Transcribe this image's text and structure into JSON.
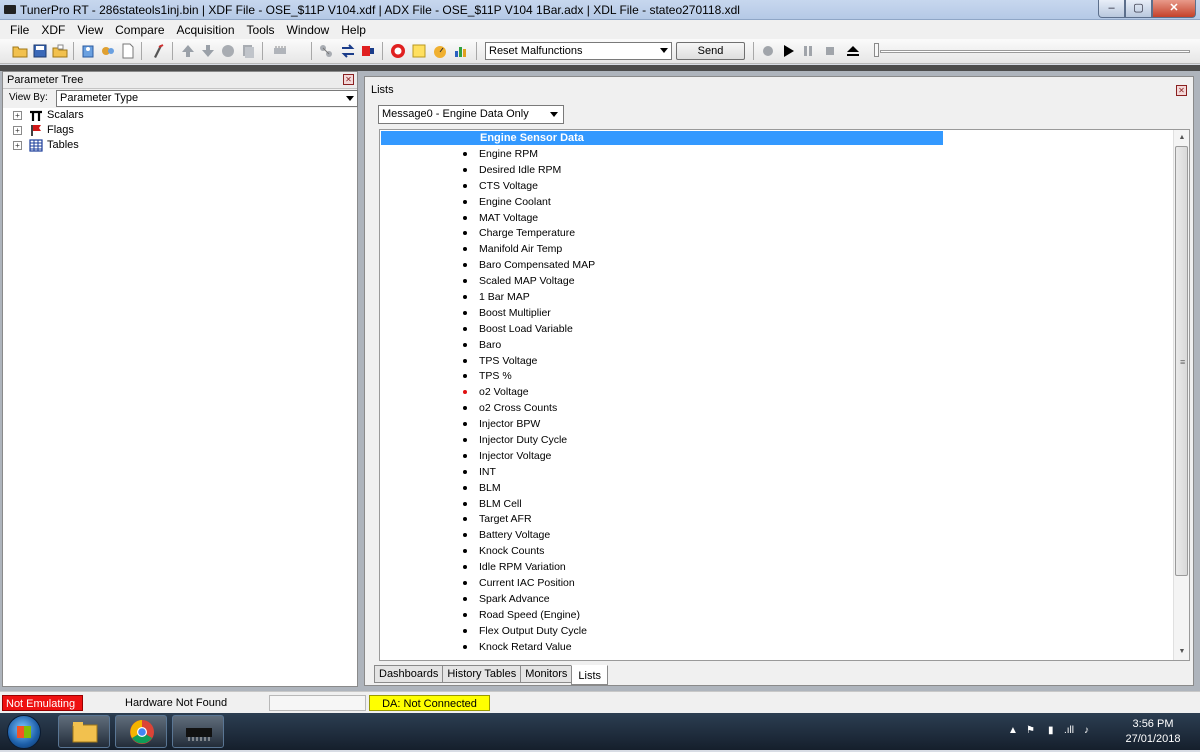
{
  "window": {
    "title": "TunerPro RT - 286stateols1inj.bin | XDF File - OSE_$11P V104.xdf | ADX File - OSE_$11P V104 1Bar.adx | XDL File - stateo270118.xdl",
    "min": "–",
    "max": "▢",
    "close": "✕"
  },
  "menu": [
    "File",
    "XDF",
    "View",
    "Compare",
    "Acquisition",
    "Tools",
    "Window",
    "Help"
  ],
  "toolbar": {
    "command_select": "Reset Malfunctions",
    "send_label": "Send"
  },
  "param_tree": {
    "title": "Parameter Tree",
    "view_by_label": "View By:",
    "view_by_value": "Parameter Type",
    "items": [
      {
        "label": "Scalars",
        "icon": "pi-icon"
      },
      {
        "label": "Flags",
        "icon": "flag-icon"
      },
      {
        "label": "Tables",
        "icon": "table-icon"
      }
    ]
  },
  "lists_pane": {
    "title": "Lists",
    "message_select": "Message0 - Engine Data Only",
    "header": "Engine Sensor Data",
    "items": [
      "Engine RPM",
      "Desired Idle RPM",
      "CTS Voltage",
      "Engine Coolant",
      "MAT Voltage",
      "Charge Temperature",
      "Manifold Air Temp",
      "Baro Compensated MAP",
      "Scaled MAP Voltage",
      "1 Bar MAP",
      "Boost Multiplier",
      "Boost Load Variable",
      "Baro",
      "TPS Voltage",
      "TPS %",
      "o2 Voltage",
      "o2 Cross Counts",
      "Injector BPW",
      "Injector Duty Cycle",
      "Injector Voltage",
      "INT",
      "BLM",
      "BLM Cell",
      "Target AFR",
      "Battery Voltage",
      "Knock Counts",
      "Idle RPM Variation",
      "Current IAC Position",
      "Spark Advance",
      "Road Speed (Engine)",
      "Flex Output Duty Cycle",
      "Knock Retard Value"
    ],
    "highlight_item": "o2 Voltage",
    "tabs": [
      "Dashboards",
      "History Tables",
      "Monitors",
      "Lists"
    ],
    "active_tab": "Lists"
  },
  "status": {
    "emulation": "Not Emulating",
    "hardware": "Hardware Not Found",
    "da": "DA: Not Connected"
  },
  "taskbar": {
    "time": "3:56 PM",
    "date": "27/01/2018",
    "apps": [
      "file-explorer-icon",
      "chrome-icon",
      "chip-icon"
    ]
  },
  "colors": {
    "selection": "#3399ff",
    "not_emulating": "#ee1111",
    "da_status": "#ffff00"
  }
}
